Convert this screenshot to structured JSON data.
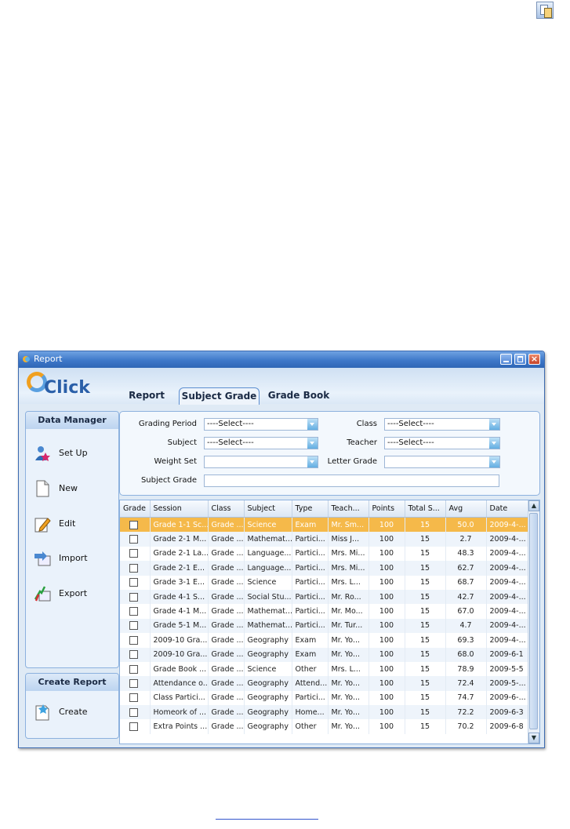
{
  "window": {
    "title": "Report",
    "controls": {
      "minimize": "",
      "maximize": "",
      "close": "×"
    }
  },
  "logo": {
    "text": "Click"
  },
  "tabs": [
    {
      "label": "Report",
      "active": false
    },
    {
      "label": "Subject Grade",
      "active": true
    },
    {
      "label": "Grade Book",
      "active": false
    }
  ],
  "sidebar": {
    "data_manager": {
      "title": "Data Manager",
      "items": [
        {
          "label": "Set Up",
          "icon": "user-setup-icon"
        },
        {
          "label": "New",
          "icon": "new-document-icon"
        },
        {
          "label": "Edit",
          "icon": "edit-pencil-icon"
        },
        {
          "label": "Import",
          "icon": "import-icon"
        },
        {
          "label": "Export",
          "icon": "export-icon"
        }
      ]
    },
    "create_report": {
      "title": "Create Report",
      "items": [
        {
          "label": "Create",
          "icon": "create-report-icon"
        }
      ]
    }
  },
  "filters": {
    "grading_period": {
      "label": "Grading Period",
      "value": "----Select----"
    },
    "subject": {
      "label": "Subject",
      "value": "----Select----"
    },
    "weight_set": {
      "label": "Weight Set",
      "value": ""
    },
    "subject_grade": {
      "label": "Subject Grade",
      "value": ""
    },
    "class": {
      "label": "Class",
      "value": "----Select----"
    },
    "teacher": {
      "label": "Teacher",
      "value": "----Select----"
    },
    "letter_grade": {
      "label": "Letter Grade",
      "value": ""
    }
  },
  "table": {
    "columns": [
      "Grade",
      "Session",
      "Class",
      "Subject",
      "Type",
      "Teach...",
      "Points",
      "Total S...",
      "Avg",
      "Date"
    ],
    "rows": [
      [
        "",
        "Grade 1-1 Sc...",
        "Grade ...",
        "Science",
        "Exam",
        "Mr. Sm...",
        "100",
        "15",
        "50.0",
        "2009-4-..."
      ],
      [
        "",
        "Grade 2-1 M...",
        "Grade ...",
        "Mathemat...",
        "Partici...",
        "Miss J...",
        "100",
        "15",
        "2.7",
        "2009-4-..."
      ],
      [
        "",
        "Grade 2-1 La...",
        "Grade ...",
        "Language...",
        "Partici...",
        "Mrs. Mi...",
        "100",
        "15",
        "48.3",
        "2009-4-..."
      ],
      [
        "",
        "Grade 2-1 E...",
        "Grade ...",
        "Language...",
        "Partici...",
        "Mrs. Mi...",
        "100",
        "15",
        "62.7",
        "2009-4-..."
      ],
      [
        "",
        "Grade 3-1 E...",
        "Grade ...",
        "Science",
        "Partici...",
        "Mrs. L...",
        "100",
        "15",
        "68.7",
        "2009-4-..."
      ],
      [
        "",
        "Grade 4-1 S...",
        "Grade ...",
        "Social Stu...",
        "Partici...",
        "Mr. Ro...",
        "100",
        "15",
        "42.7",
        "2009-4-..."
      ],
      [
        "",
        "Grade 4-1 M...",
        "Grade ...",
        "Mathemat...",
        "Partici...",
        "Mr. Mo...",
        "100",
        "15",
        "67.0",
        "2009-4-..."
      ],
      [
        "",
        "Grade 5-1 M...",
        "Grade ...",
        "Mathemat...",
        "Partici...",
        "Mr. Tur...",
        "100",
        "15",
        "4.7",
        "2009-4-..."
      ],
      [
        "",
        "2009-10 Gra...",
        "Grade ...",
        "Geography",
        "Exam",
        "Mr. Yo...",
        "100",
        "15",
        "69.3",
        "2009-4-..."
      ],
      [
        "",
        "2009-10 Gra...",
        "Grade ...",
        "Geography",
        "Exam",
        "Mr. Yo...",
        "100",
        "15",
        "68.0",
        "2009-6-1"
      ],
      [
        "",
        "Grade Book ...",
        "Grade ...",
        "Science",
        "Other",
        "Mrs. L...",
        "100",
        "15",
        "78.9",
        "2009-5-5"
      ],
      [
        "",
        "Attendance o...",
        "Grade ...",
        "Geography",
        "Attend...",
        "Mr. Yo...",
        "100",
        "15",
        "72.4",
        "2009-5-..."
      ],
      [
        "",
        "Class Partici...",
        "Grade ...",
        "Geography",
        "Partici...",
        "Mr. Yo...",
        "100",
        "15",
        "74.7",
        "2009-6-..."
      ],
      [
        "",
        "Homeork of ...",
        "Grade ...",
        "Geography",
        "Home...",
        "Mr. Yo...",
        "100",
        "15",
        "72.2",
        "2009-6-3"
      ],
      [
        "",
        "Extra Points ...",
        "Grade ...",
        "Geography",
        "Other",
        "Mr. Yo...",
        "100",
        "15",
        "70.2",
        "2009-6-8"
      ]
    ],
    "selected_row": 0
  },
  "colors": {
    "title_bar": "#3e78c9",
    "selected_row": "#f5b94a",
    "panel_border": "#8cb1de"
  }
}
